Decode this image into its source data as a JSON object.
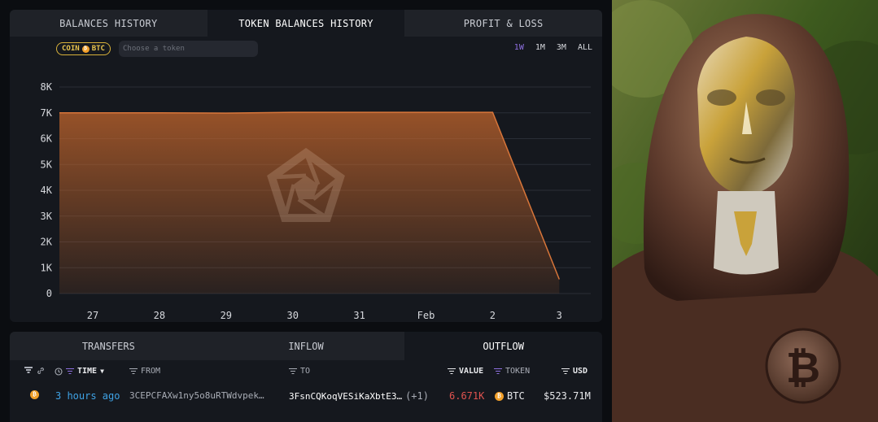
{
  "tabs_top": [
    {
      "label": "BALANCES HISTORY",
      "active": false
    },
    {
      "label": "TOKEN BALANCES HISTORY",
      "active": true
    },
    {
      "label": "PROFIT & LOSS",
      "active": false
    }
  ],
  "coin_badge": {
    "prefix": "COIN",
    "symbol": "BTC"
  },
  "token_search": {
    "placeholder": "Choose a token"
  },
  "ranges": [
    {
      "label": "1W",
      "active": true
    },
    {
      "label": "1M",
      "active": false
    },
    {
      "label": "3M",
      "active": false
    },
    {
      "label": "ALL",
      "active": false
    }
  ],
  "colors": {
    "accent": "#8e6fe0",
    "area": "#c2652c",
    "link": "#3fa3e6",
    "negative": "#e0534f",
    "btc": "#f2a02a"
  },
  "chart_data": {
    "type": "area",
    "title": "",
    "xlabel": "",
    "ylabel": "",
    "x_ticks": [
      "27",
      "28",
      "29",
      "30",
      "31",
      "Feb",
      "2",
      "3"
    ],
    "y_ticks": [
      "0",
      "1K",
      "2K",
      "3K",
      "4K",
      "5K",
      "6K",
      "7K",
      "8K"
    ],
    "ylim": [
      0,
      8000
    ],
    "grid": true,
    "series": [
      {
        "values": [
          {
            "x": "26.5",
            "y": 7000
          },
          {
            "x": "27",
            "y": 7000
          },
          {
            "x": "28",
            "y": 7000
          },
          {
            "x": "29",
            "y": 6990
          },
          {
            "x": "30",
            "y": 7020
          },
          {
            "x": "31",
            "y": 7020
          },
          {
            "x": "Feb",
            "y": 7020
          },
          {
            "x": "2",
            "y": 7020
          },
          {
            "x": "3",
            "y": 550
          }
        ]
      }
    ]
  },
  "tabs_bottom": [
    {
      "label": "TRANSFERS",
      "active": false
    },
    {
      "label": "INFLOW",
      "active": false
    },
    {
      "label": "OUTFLOW",
      "active": true
    }
  ],
  "table": {
    "headers": {
      "time": "TIME",
      "from": "FROM",
      "to": "TO",
      "value": "VALUE",
      "token": "TOKEN",
      "usd": "USD"
    },
    "rows": [
      {
        "time": "3 hours ago",
        "from": "3CEPCFAXw1ny5o8uRTWdvpek…",
        "to": "3FsnCQKoqVESiKaXbtE3…",
        "to_extra": "(+1)",
        "value": "6.671K",
        "token": "BTC",
        "usd": "$523.71M"
      }
    ]
  },
  "photo": {
    "description_icon": "bitcoin-symbol"
  }
}
